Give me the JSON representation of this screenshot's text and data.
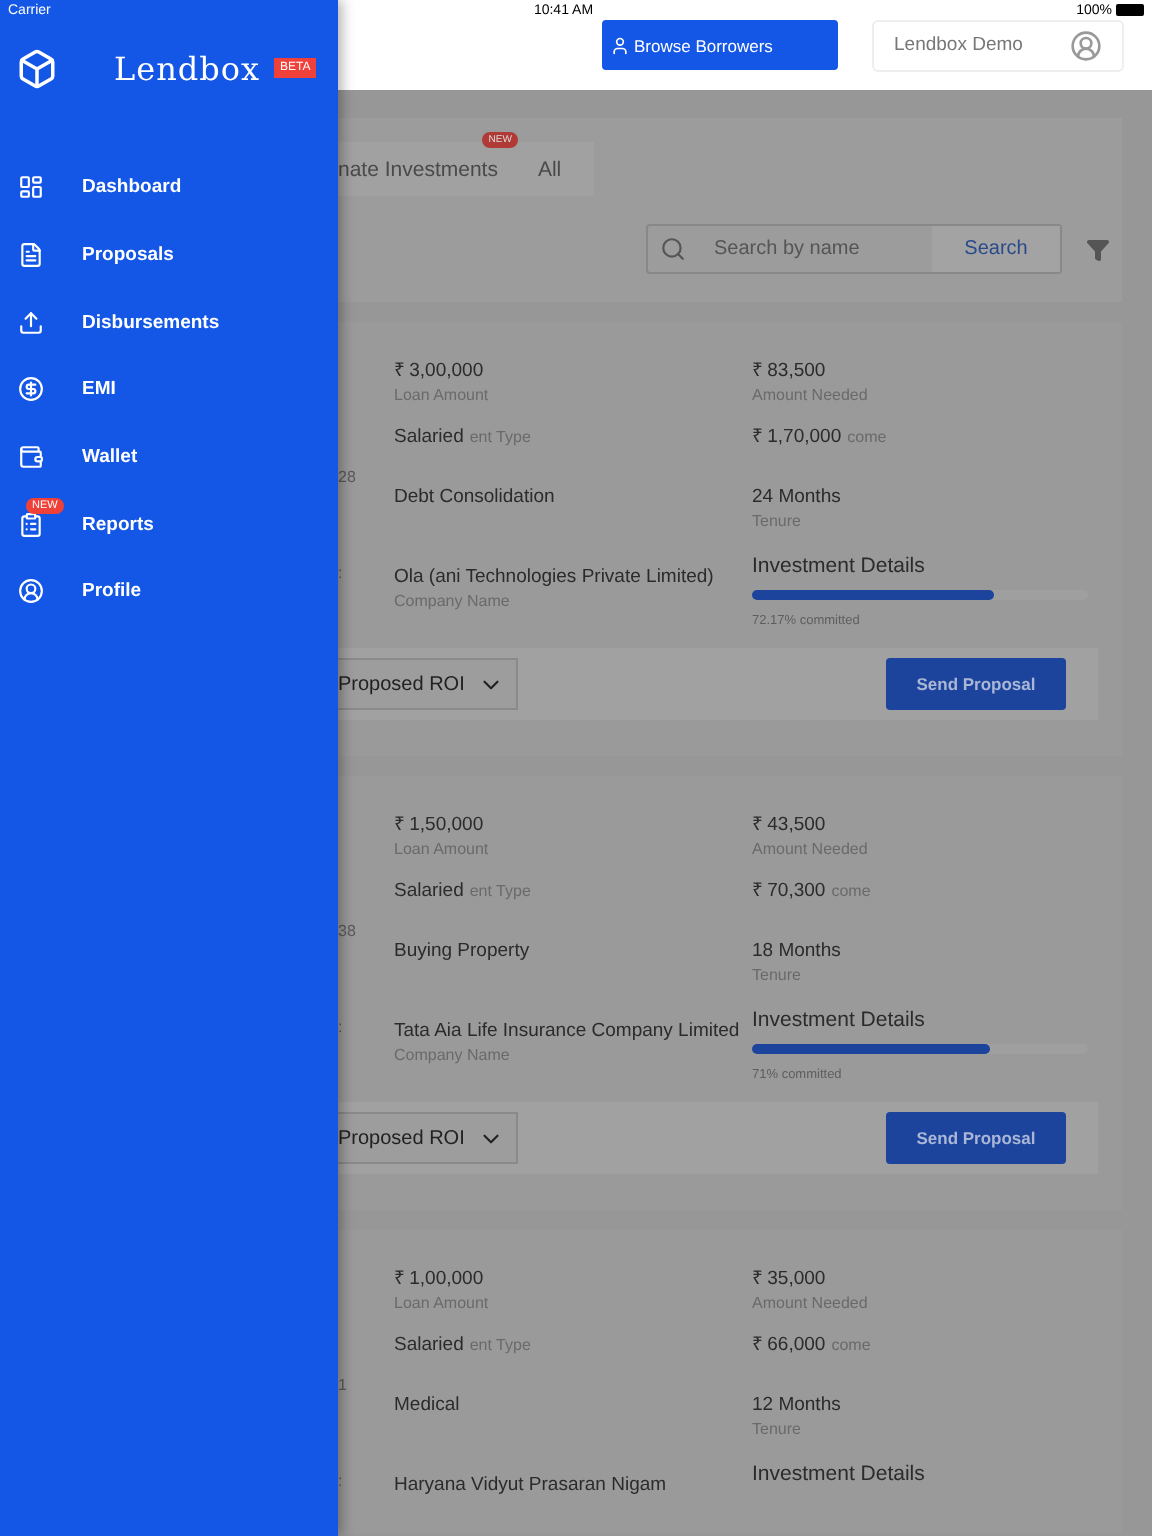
{
  "status_bar": {
    "carrier": "Carrier",
    "time": "10:41 AM",
    "battery": "100%"
  },
  "drawer": {
    "brand": "Lendbox",
    "badge": "BETA",
    "items": [
      {
        "label": "Dashboard"
      },
      {
        "label": "Proposals"
      },
      {
        "label": "Disbursements"
      },
      {
        "label": "EMI"
      },
      {
        "label": "Wallet"
      },
      {
        "label": "Reports",
        "badge": "NEW"
      },
      {
        "label": "Profile"
      }
    ]
  },
  "header": {
    "browse_button": "Browse Borrowers",
    "account": "Lendbox Demo"
  },
  "tabs": [
    {
      "label": "nate Investments",
      "badge": "NEW",
      "selected": false
    },
    {
      "label": "All",
      "selected": false
    }
  ],
  "search": {
    "placeholder": "Search by name",
    "button": "Search"
  },
  "cards": [
    {
      "loan_amount": "₹ 3,00,000",
      "loan_amount_label": "Loan Amount",
      "amount_needed": "₹ 83,500",
      "amount_needed_label": "Amount Needed",
      "employment": "Salaried",
      "employment_label": "ent Type",
      "income": "₹ 1,70,000",
      "income_label": "come",
      "purpose": "Debt Consolidation",
      "tenure": "24 Months",
      "tenure_label": "Tenure",
      "company": "Ola (ani Technologies Private Limited)",
      "company_label": "Company Name",
      "investment_title": "Investment Details",
      "level": 0.7217,
      "committed": "72.17% committed",
      "fragments": [
        "28",
        ":"
      ],
      "roi": "Proposed ROI",
      "send": "Send Proposal"
    },
    {
      "loan_amount": "₹ 1,50,000",
      "loan_amount_label": "Loan Amount",
      "amount_needed": "₹ 43,500",
      "amount_needed_label": "Amount Needed",
      "employment": "Salaried",
      "employment_label": "ent Type",
      "income": "₹ 70,300",
      "income_label": "come",
      "purpose": "Buying Property",
      "tenure": "18 Months",
      "tenure_label": "Tenure",
      "company": "Tata Aia Life Insurance Company Limited",
      "company_label": "Company Name",
      "investment_title": "Investment Details",
      "level": 0.71,
      "committed": "71% committed",
      "fragments": [
        "38",
        ":"
      ],
      "roi": "Proposed ROI",
      "send": "Send Proposal"
    },
    {
      "loan_amount": "₹ 1,00,000",
      "loan_amount_label": "Loan Amount",
      "amount_needed": "₹ 35,000",
      "amount_needed_label": "Amount Needed",
      "employment": "Salaried",
      "employment_label": "ent Type",
      "income": "₹ 66,000",
      "income_label": "come",
      "purpose": "Medical",
      "tenure": "12 Months",
      "tenure_label": "Tenure",
      "company": "Haryana Vidyut Prasaran Nigam",
      "investment_title": "Investment Details",
      "fragments": [
        "1",
        ":"
      ]
    }
  ]
}
